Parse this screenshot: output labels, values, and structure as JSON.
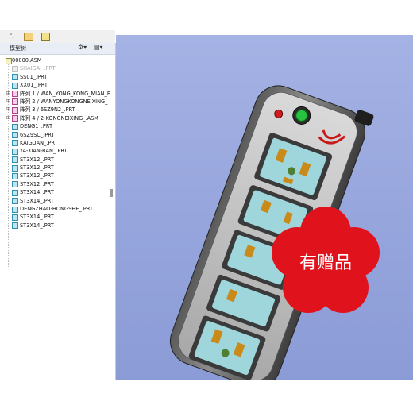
{
  "toolbar": {
    "icons": [
      "settings-icon",
      "folder-icon",
      "picture-icon"
    ]
  },
  "model_tree_panel": {
    "title": "模型树",
    "header_buttons": [
      "tree-settings-icon",
      "tree-columns-icon"
    ],
    "items": [
      {
        "label": "00000.ASM",
        "type": "root"
      },
      {
        "label": "SHAIGAI_.PRT",
        "type": "suppressed"
      },
      {
        "label": "SS01_.PRT",
        "type": "part"
      },
      {
        "label": "XX01_.PRT",
        "type": "part"
      },
      {
        "label": "阵列 1 / WAN_YONG_KONG_MIAN_E",
        "type": "pattern"
      },
      {
        "label": "阵列 2 / WANYONGKONGNEIXING_",
        "type": "pattern"
      },
      {
        "label": "阵列 3 / 6SZ9N2_.PRT",
        "type": "pattern"
      },
      {
        "label": "阵列 4 / 2-KONGNEIXING_.ASM",
        "type": "pattern"
      },
      {
        "label": "DENG1_.PRT",
        "type": "part"
      },
      {
        "label": "6SZ9SC_.PRT",
        "type": "part"
      },
      {
        "label": "KAIGUAN_.PRT",
        "type": "part"
      },
      {
        "label": "YA-XIAN-BAN_.PRT",
        "type": "part"
      },
      {
        "label": "ST3X12_.PRT",
        "type": "part"
      },
      {
        "label": "ST3X12_.PRT",
        "type": "part"
      },
      {
        "label": "ST3X12_.PRT",
        "type": "part"
      },
      {
        "label": "ST3X12_.PRT",
        "type": "part"
      },
      {
        "label": "ST3X14_.PRT",
        "type": "part"
      },
      {
        "label": "ST3X14_.PRT",
        "type": "part"
      },
      {
        "label": "DENGZHAO-HONGSHE_.PRT",
        "type": "part"
      },
      {
        "label": "ST3X14_.PRT",
        "type": "part"
      },
      {
        "label": "ST3X14_.PRT",
        "type": "part"
      }
    ]
  },
  "viewport": {
    "background_color": "#97a6dd",
    "model": "power-strip",
    "overlay_badge_text": "有赠品",
    "badge_color": "#e0131c"
  }
}
